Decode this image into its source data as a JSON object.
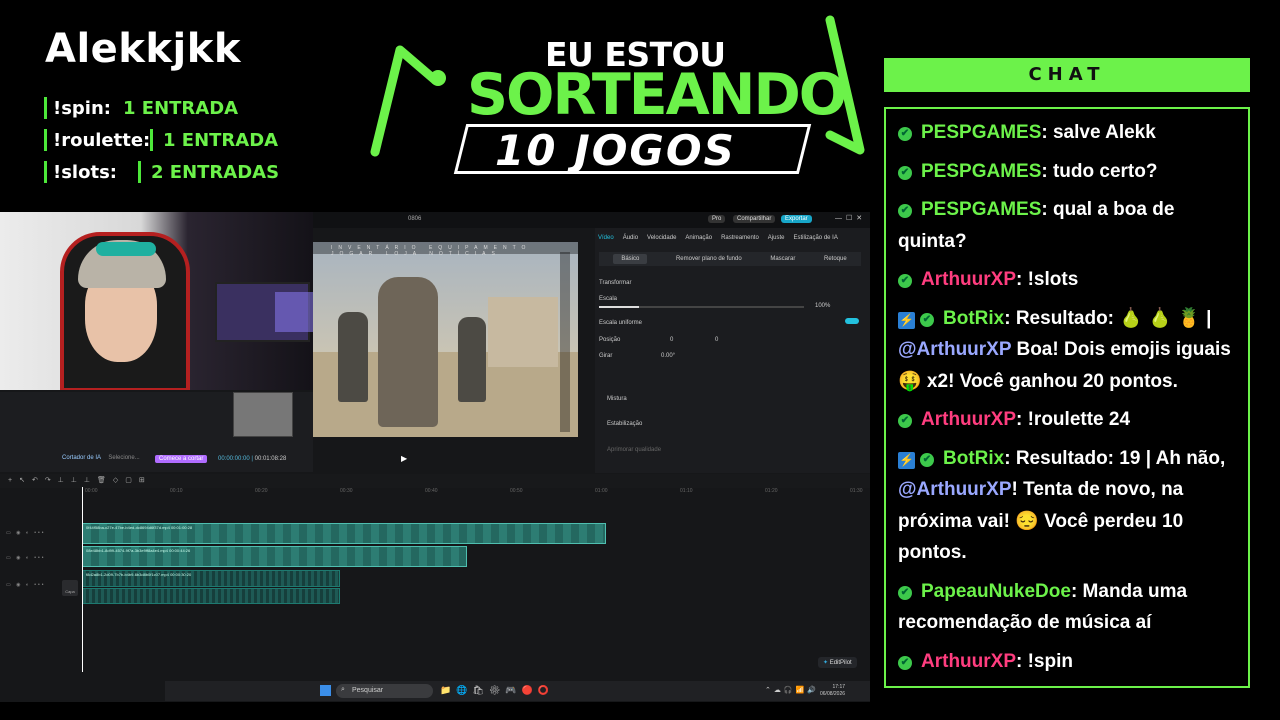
{
  "overlay": {
    "streamer_name": "Alekkjkk",
    "commands": [
      {
        "cmd": "!spin:",
        "value": "1 ENTRADA"
      },
      {
        "cmd": "!roulette:",
        "value": "1 ENTRADA"
      },
      {
        "cmd": "!slots:",
        "value": "2 ENTRADAS"
      }
    ],
    "banner": {
      "line1": "EU ESTOU",
      "line2": "SORTEANDO",
      "line3": "10 JOGOS"
    }
  },
  "chat": {
    "header": "CHAT",
    "messages": [
      {
        "user": "PESPGAMES",
        "color": "green",
        "bot": false,
        "text": ": salve Alekk"
      },
      {
        "user": "PESPGAMES",
        "color": "green",
        "bot": false,
        "text": ": tudo certo?"
      },
      {
        "user": "PESPGAMES",
        "color": "green",
        "bot": false,
        "text": ": qual a boa de quinta?"
      },
      {
        "user": "ArthuurXP",
        "color": "pink",
        "bot": false,
        "text": ": !slots"
      },
      {
        "user": "BotRix",
        "color": "green",
        "bot": true,
        "text": ": Resultado: 🍐 🍐 🍍 |",
        "mention": "@ArthuurXP",
        "text2": " Boa! Dois emojis iguais 🤑 x2! Você ganhou 20 pontos."
      },
      {
        "user": "ArthuurXP",
        "color": "pink",
        "bot": false,
        "text": ": !roulette 24"
      },
      {
        "user": "BotRix",
        "color": "green",
        "bot": true,
        "text": ": Resultado: 19 | Ah não,",
        "mention": "@ArthuurXP",
        "text2": "! Tenta de novo, na próxima vai! 😔 Você perdeu 10 pontos."
      },
      {
        "user": "PapeauNukeDoe",
        "color": "green",
        "bot": false,
        "text": ": Manda uma recomendação de música aí"
      },
      {
        "user": "ArthuurXP",
        "color": "pink",
        "bot": false,
        "text": ": !spin"
      }
    ]
  },
  "editor": {
    "title": "0806",
    "pro_label": "Pro",
    "share_label": "Compartilhar",
    "export_label": "Exportar",
    "game_menu": "INVENTÁRIO  EQUIPAMENTO  JOGAR  LOJA  NOTÍCIAS",
    "cortador_label": "Cortador de IA",
    "selecione_label": "Selecione...",
    "comece_label": "Comece a cortar",
    "time_current": "00:00:00:00",
    "time_total": "00:01:08:28",
    "right_tabs": [
      "Vídeo",
      "Áudio",
      "Velocidade",
      "Animação",
      "Rastreamento",
      "Ajuste",
      "Estilização de IA"
    ],
    "right_subtabs": [
      "Básico",
      "Remover plano de fundo",
      "Mascarar",
      "Retoque"
    ],
    "transform_label": "Transformar",
    "scale_label": "Escala",
    "scale_value": "100%",
    "uniform_label": "Escala uniforme",
    "position_label": "Posição",
    "pos_x": "0",
    "pos_y": "0",
    "rotate_label": "Girar",
    "rotate_value": "0.00°",
    "blend_label": "Mistura",
    "stabilize_label": "Estabilização",
    "improve_label": "Aprimorar qualidade",
    "capa_label": "Capa",
    "editpilot_label": "EditPilot",
    "clip1_name": "0f44f58ba-c27e-47be-b4ed-dc8694d6f37d.mp4  00:01:00:28",
    "clip2_name": "08e48bb1-8d99-4574-9f7a-3b3e9ff8a4e4.mp4  00:00:44:26",
    "clip3_name": "f8d2a8b1-2d09-7b7b-b4b9-6b3d8b0f1c07.mp4  00:00:30:20",
    "ruler_marks": [
      "00:00",
      "00:10",
      "00:20",
      "00:30",
      "00:40",
      "00:50",
      "01:00",
      "01:10",
      "01:20",
      "01:30"
    ]
  },
  "taskbar": {
    "search_placeholder": "Pesquisar",
    "time": "17:17",
    "date": "06/08/2026"
  }
}
